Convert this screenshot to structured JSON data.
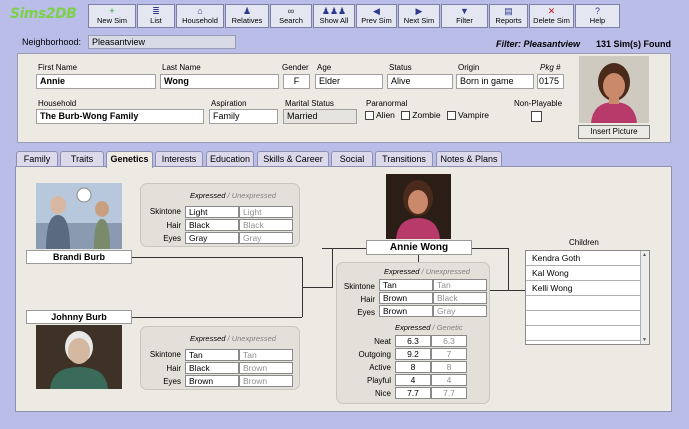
{
  "app": {
    "logo": "Sims2DB"
  },
  "toolbar": [
    {
      "label": "New Sim",
      "icon": "plus-icon",
      "glyph": "+"
    },
    {
      "label": "List",
      "icon": "list-icon",
      "glyph": "≣"
    },
    {
      "label": "Household",
      "icon": "house-icon",
      "glyph": "⌂"
    },
    {
      "label": "Relatives",
      "icon": "relatives-icon",
      "glyph": "♟"
    },
    {
      "label": "Search",
      "icon": "binoculars-icon",
      "glyph": "∞"
    },
    {
      "label": "Show All",
      "icon": "people-icon",
      "glyph": "♟♟♟"
    },
    {
      "label": "Prev Sim",
      "icon": "prev-arrow-icon",
      "glyph": "◀"
    },
    {
      "label": "Next Sim",
      "icon": "next-arrow-icon",
      "glyph": "▶"
    },
    {
      "label": "Filter",
      "icon": "filter-icon",
      "glyph": "▼"
    },
    {
      "label": "Reports",
      "icon": "reports-icon",
      "glyph": "▤"
    },
    {
      "label": "Delete Sim",
      "icon": "delete-icon",
      "glyph": "✕"
    },
    {
      "label": "Help",
      "icon": "help-icon",
      "glyph": "?"
    }
  ],
  "neighborhood": {
    "label": "Neighborhood:",
    "value": "Pleasantview"
  },
  "filter_text": "Filter: Pleasantview",
  "count_text": "131 Sim(s) Found",
  "sim": {
    "first_name_label": "First Name",
    "first_name": "Annie",
    "last_name_label": "Last Name",
    "last_name": "Wong",
    "gender_label": "Gender",
    "gender": "F",
    "age_label": "Age",
    "age": "Elder",
    "status_label": "Status",
    "status": "Alive",
    "origin_label": "Origin",
    "origin": "Born in game",
    "pkg_label": "Pkg #",
    "pkg": "0175",
    "household_label": "Household",
    "household": "The Burb-Wong Family",
    "aspiration_label": "Aspiration",
    "aspiration": "Family",
    "marital_label": "Marital Status",
    "marital": "Married",
    "paranormal_label": "Paranormal",
    "paranormal": [
      {
        "label": "Alien",
        "checked": false
      },
      {
        "label": "Zombie",
        "checked": false
      },
      {
        "label": "Vampire",
        "checked": false
      }
    ],
    "nonplayable_label": "Non-Playable",
    "nonplayable": false,
    "insert_picture": "Insert Picture"
  },
  "tabs": [
    {
      "label": "Family",
      "active": false
    },
    {
      "label": "Traits",
      "active": false
    },
    {
      "label": "Genetics",
      "active": true
    },
    {
      "label": "Interests",
      "active": false
    },
    {
      "label": "Education",
      "active": false
    },
    {
      "label": "Skills & Career",
      "active": false
    },
    {
      "label": "Social",
      "active": false
    },
    {
      "label": "Transitions",
      "active": false
    },
    {
      "label": "Notes & Plans",
      "active": false
    }
  ],
  "genetics": {
    "expressed": "Expressed",
    "unexpressed": "Unexpressed",
    "genetic": "Genetic",
    "slash": "/",
    "row_labels": {
      "skintone": "Skintone",
      "hair": "Hair",
      "eyes": "Eyes"
    },
    "parent1": {
      "name": "Brandi Burb",
      "skintone": [
        "Light",
        "Light"
      ],
      "hair": [
        "Black",
        "Black"
      ],
      "eyes": [
        "Gray",
        "Gray"
      ]
    },
    "parent2": {
      "name": "Johnny Burb",
      "skintone": [
        "Tan",
        "Tan"
      ],
      "hair": [
        "Black",
        "Brown"
      ],
      "eyes": [
        "Brown",
        "Brown"
      ]
    },
    "self": {
      "name": "Annie Wong",
      "skintone": [
        "Tan",
        "Tan"
      ],
      "hair": [
        "Brown",
        "Black"
      ],
      "eyes": [
        "Brown",
        "Gray"
      ]
    },
    "personality": [
      {
        "label": "Neat",
        "expressed": "6.3",
        "genetic": "6.3"
      },
      {
        "label": "Outgoing",
        "expressed": "9.2",
        "genetic": "7"
      },
      {
        "label": "Active",
        "expressed": "8",
        "genetic": "8"
      },
      {
        "label": "Playful",
        "expressed": "4",
        "genetic": "4"
      },
      {
        "label": "Nice",
        "expressed": "7.7",
        "genetic": "7.7"
      }
    ],
    "children_label": "Children",
    "children": [
      "Kendra Goth",
      "Kal Wong",
      "Kelli Wong",
      "",
      "",
      ""
    ]
  }
}
